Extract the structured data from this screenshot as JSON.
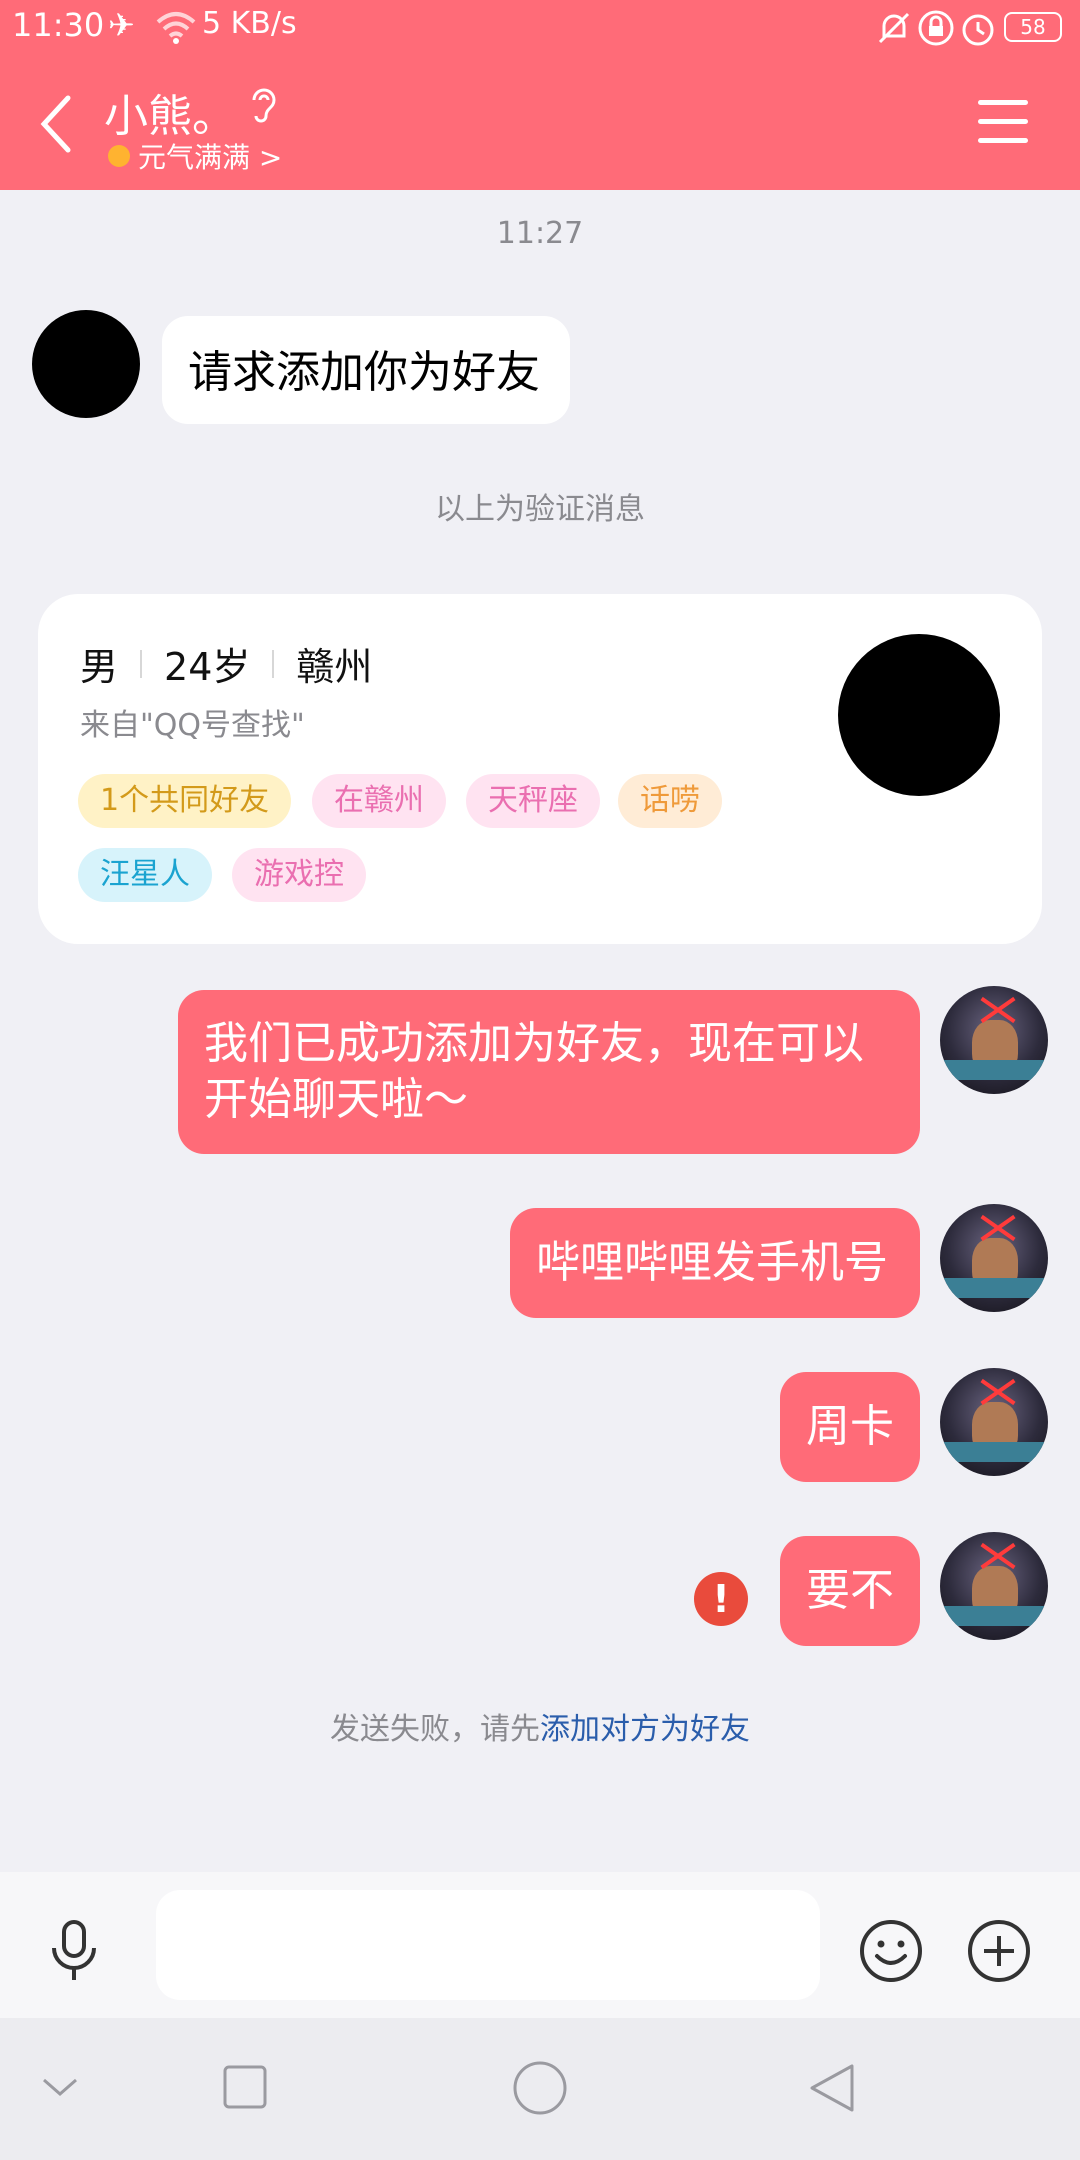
{
  "status_bar": {
    "time": "11:30",
    "network_speed": "5 KB/s",
    "battery": "58"
  },
  "header": {
    "title": "小熊。",
    "subtitle": "元气满满 >"
  },
  "chat": {
    "timestamp": "11:27",
    "request_message": "请求添加你为好友",
    "verification_note": "以上为验证消息",
    "profile_card": {
      "gender": "男",
      "age": "24岁",
      "location": "赣州",
      "source": "来自\"QQ号查找\"",
      "tags": [
        "1个共同好友",
        "在赣州",
        "天秤座",
        "话唠",
        "汪星人",
        "游戏控"
      ]
    },
    "sent_messages": [
      "我们已成功添加为好友，现在可以开始聊天啦～",
      "哔哩哔哩发手机号",
      "周卡",
      "要不"
    ],
    "error_icon": "!",
    "failure_prefix": "发送失败，请先",
    "failure_link": "添加对方为好友"
  },
  "input": {
    "placeholder": ""
  },
  "colors": {
    "header": "#ff6b78",
    "bubble_sent": "#ff6b78",
    "background": "#f0f0f5",
    "error": "#e94b3c",
    "link": "#2a5dab"
  }
}
